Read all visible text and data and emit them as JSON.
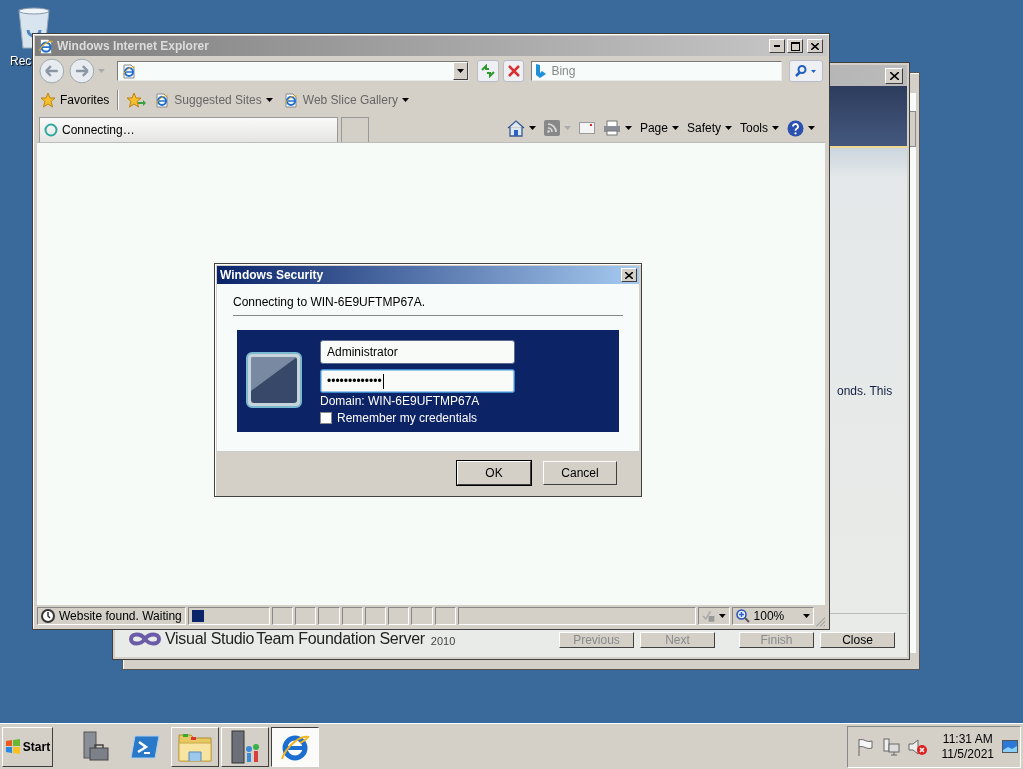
{
  "desktop_icons": [
    {
      "label": "Rec"
    }
  ],
  "wizard": {
    "body_text": "onds. This",
    "logo_name": "Visual Studio",
    "logo_product": "Team Foundation Server",
    "logo_year": "2010",
    "buttons": [
      {
        "label": "Previous",
        "disabled": true
      },
      {
        "label": "Next",
        "disabled": true
      },
      {
        "label": "Finish",
        "disabled": true
      },
      {
        "label": "Close",
        "disabled": false
      }
    ]
  },
  "browser": {
    "title": "Windows Internet Explorer",
    "search": {
      "placeholder": "Bing"
    },
    "favorites_bar": {
      "favorites": "Favorites",
      "links": [
        {
          "label": "Suggested Sites"
        },
        {
          "label": "Web Slice Gallery"
        }
      ]
    },
    "tabs": [
      {
        "label": "Connecting…",
        "selected": true
      }
    ],
    "command_bar": [
      {
        "label": "Page"
      },
      {
        "label": "Safety"
      },
      {
        "label": "Tools"
      }
    ],
    "status_bar": {
      "text": "Website found. Waiting",
      "zoom": "100%"
    }
  },
  "dialog": {
    "title": "Windows Security",
    "message": "Connecting to WIN-6E9UFTMP67A.",
    "username": "Administrator",
    "password": "•••••••••••••",
    "domain": "Domain: WIN-6E9UFTMP67A",
    "remember": {
      "label": "Remember my credentials",
      "checked": false
    },
    "buttons": [
      {
        "label": "OK",
        "default": true
      },
      {
        "label": "Cancel",
        "default": false
      }
    ]
  },
  "taskbar": {
    "start": "Start",
    "apps": [
      {
        "kind": "server-manager",
        "open": false,
        "selected": false
      },
      {
        "kind": "powershell",
        "open": false,
        "selected": false
      },
      {
        "kind": "explorer",
        "open": true,
        "selected": false
      },
      {
        "kind": "server-users",
        "open": true,
        "selected": false
      },
      {
        "kind": "browser",
        "open": true,
        "selected": true
      }
    ],
    "time": "11:31 AM",
    "date": "11/5/2021"
  }
}
